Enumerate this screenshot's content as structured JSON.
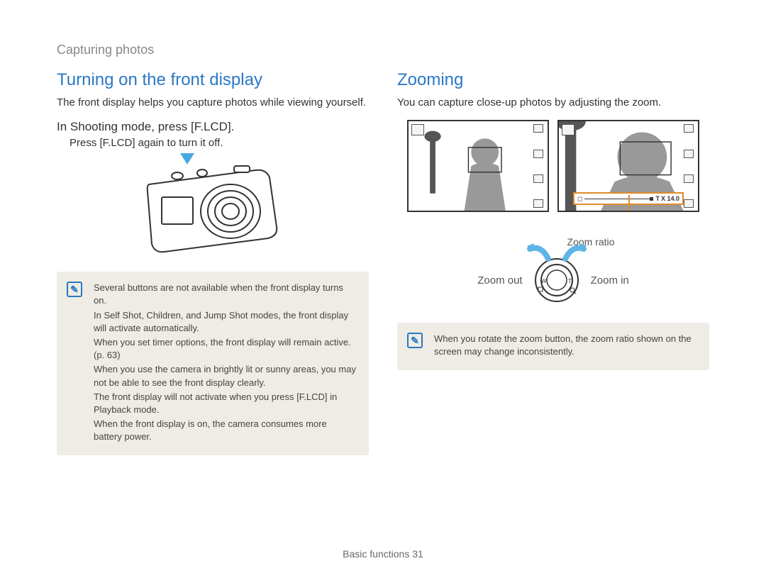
{
  "breadcrumb": "Capturing photos",
  "left": {
    "heading": "Turning on the front display",
    "intro": "The front display helps you capture photos while viewing yourself.",
    "instruction": "In Shooting mode, press [F.LCD].",
    "sub": "Press [F.LCD] again to turn it off.",
    "notes": [
      "Several buttons are not available when the front display turns on.",
      "In Self Shot, Children, and Jump Shot modes, the front display will activate automatically.",
      "When you set timer options, the front display will remain active. (p. 63)",
      "When you use the camera in brightly lit or sunny areas, you may not be able to see the front display clearly.",
      "The front display will not activate when you press [F.LCD] in Playback mode.",
      "When the front display is on, the camera consumes more battery power."
    ]
  },
  "right": {
    "heading": "Zooming",
    "intro": "You can capture close-up photos by adjusting the zoom.",
    "zoom_ratio_label": "Zoom ratio",
    "zoom_out": "Zoom out",
    "zoom_in": "Zoom in",
    "zoom_bar_text": "X 14.0",
    "dial_w": "W",
    "dial_t": "T",
    "note": "When you rotate the zoom button, the zoom ratio shown on the screen may change inconsistently."
  },
  "footer": {
    "section": "Basic functions",
    "page": "31"
  }
}
